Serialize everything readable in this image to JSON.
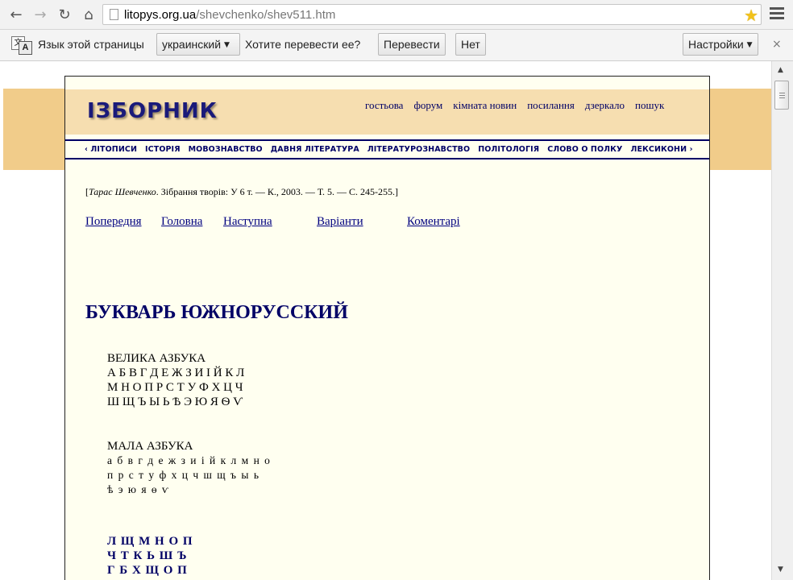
{
  "browser": {
    "url_host": "litopys.org.ua",
    "url_path": "/shevchenko/shev511.htm",
    "back_icon": "←",
    "forward_icon": "→",
    "reload_icon": "↻",
    "home_icon": "⌂",
    "star_icon": "★"
  },
  "translate_bar": {
    "page_language_label": "Язык этой страницы",
    "language_value": "украинский",
    "question": "Хотите перевести ее?",
    "translate_button": "Перевести",
    "no_button": "Нет",
    "settings_button": "Настройки",
    "close_icon": "×"
  },
  "site": {
    "logo": "ІЗБОРНИК",
    "top_links": [
      "гостьова",
      "форум",
      "кімната новин",
      "посилання",
      "дзеркало",
      "пошук"
    ],
    "categories": [
      "‹  ЛІТОПИСИ",
      "ІСТОРІЯ",
      "МОВОЗНАВСТВО",
      "ДАВНЯ ЛІТЕРАТУРА",
      "ЛІТЕРАТУРОЗНАВСТВО",
      "ПОЛІТОЛОГІЯ",
      "СЛОВО О ПОЛКУ",
      "ЛЕКСИКОНИ  ›"
    ]
  },
  "content": {
    "citation_open": "[",
    "citation_author": "Тарас Шевченко",
    "citation_rest": ". Зібрання творів: У 6 т. — К., 2003. — Т. 5. — С. 245-255.]",
    "nav_links": {
      "prev": "Попередня",
      "main": "Головна",
      "next": "Наступна",
      "variants": "Варіанти",
      "comments": "Коментарі"
    },
    "title": "БУКВАРЬ ЮЖНОРУССКИЙ",
    "upper_heading": "ВЕЛИКА АЗБУКА",
    "upper_lines": [
      "А Б В Г Д Е Ж З И І Й К Л",
      "М Н О П Р С Т У Ф Х Ц Ч",
      "Ш Щ Ъ Ы Ь Ѣ Э Ю Я Ѳ Ѵ"
    ],
    "lower_heading": "МАЛА АЗБУКА",
    "lower_lines": [
      "а б в г д е ж з и і й к л м н о",
      "п р с т у ф х ц ч ш щ ъ ы ь",
      "ѣ э ю я ѳ ѵ"
    ],
    "bold_lines": [
      "Л Щ М Н О П",
      "Ч Т К Ь Ш Ъ",
      "Г Б Х Щ О П"
    ]
  }
}
